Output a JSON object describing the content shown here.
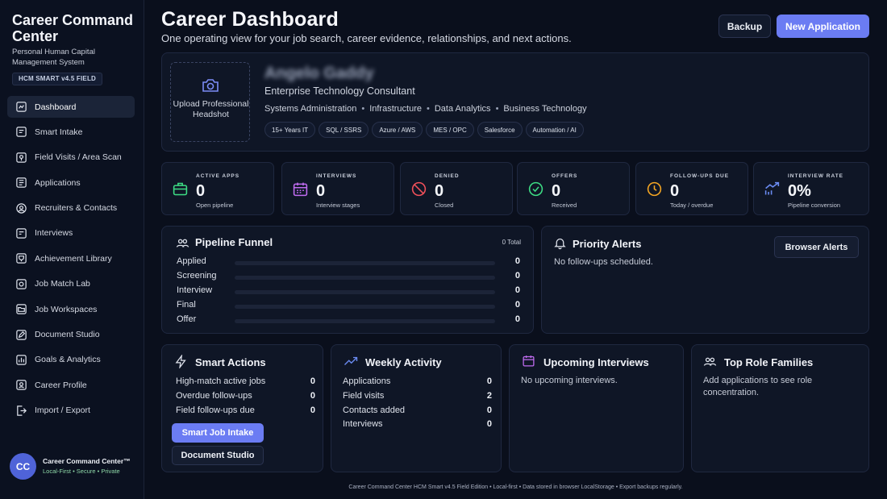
{
  "sidebar": {
    "brand_title": "Career Command Center",
    "brand_subtitle": "Personal Human Capital Management System",
    "badge": "HCM SMART v4.5 FIELD",
    "items": [
      {
        "label": "Dashboard",
        "icon": "dashboard-icon",
        "active": true
      },
      {
        "label": "Smart Intake",
        "icon": "intake-icon"
      },
      {
        "label": "Field Visits / Area Scan",
        "icon": "map-pin-icon"
      },
      {
        "label": "Applications",
        "icon": "document-icon"
      },
      {
        "label": "Recruiters & Contacts",
        "icon": "contacts-icon"
      },
      {
        "label": "Interviews",
        "icon": "chat-icon"
      },
      {
        "label": "Achievement Library",
        "icon": "trophy-icon"
      },
      {
        "label": "Job Match Lab",
        "icon": "target-icon"
      },
      {
        "label": "Job Workspaces",
        "icon": "folder-icon"
      },
      {
        "label": "Document Studio",
        "icon": "file-edit-icon"
      },
      {
        "label": "Goals & Analytics",
        "icon": "chart-icon"
      },
      {
        "label": "Career Profile",
        "icon": "user-icon"
      },
      {
        "label": "Import / Export",
        "icon": "transfer-icon"
      }
    ],
    "user": {
      "initials": "CC",
      "name": "Career Command Center™",
      "tags": "Local-First • Secure • Private"
    }
  },
  "header": {
    "title": "Career Dashboard",
    "subtitle": "One operating view for your job search, career evidence, relationships, and next actions.",
    "backup_label": "Backup",
    "new_label": "New Application"
  },
  "profile": {
    "upload_label": "Upload Professional Headshot",
    "name": "Angelo Gaddy",
    "role": "Enterprise Technology Consultant",
    "skills": [
      "Systems Administration",
      "Infrastructure",
      "Data Analytics",
      "Business Technology"
    ],
    "tags": [
      "15+ Years IT",
      "SQL / SSRS",
      "Azure / AWS",
      "MES / OPC",
      "Salesforce",
      "Automation / AI"
    ]
  },
  "stats": [
    {
      "label": "ACTIVE APPS",
      "value": "0",
      "sub": "Open pipeline",
      "icon": "briefcase-icon",
      "color": "#3ddc84"
    },
    {
      "label": "INTERVIEWS",
      "value": "0",
      "sub": "Interview stages",
      "icon": "calendar-icon",
      "color": "#c06cf0"
    },
    {
      "label": "DENIED",
      "value": "0",
      "sub": "Closed",
      "icon": "ban-icon",
      "color": "#f0505a"
    },
    {
      "label": "OFFERS",
      "value": "0",
      "sub": "Received",
      "icon": "check-circle-icon",
      "color": "#3ddc84"
    },
    {
      "label": "FOLLOW-UPS DUE",
      "value": "0",
      "sub": "Today / overdue",
      "icon": "clock-icon",
      "color": "#f5a623"
    },
    {
      "label": "INTERVIEW RATE",
      "value": "0%",
      "sub": "Pipeline conversion",
      "icon": "trend-icon",
      "color": "#6b8cf3"
    }
  ],
  "funnel": {
    "title": "Pipeline Funnel",
    "total": "0 Total",
    "rows": [
      {
        "label": "Applied",
        "value": "0",
        "fill": 0
      },
      {
        "label": "Screening",
        "value": "0",
        "fill": 0
      },
      {
        "label": "Interview",
        "value": "0",
        "fill": 0
      },
      {
        "label": "Final",
        "value": "0",
        "fill": 0
      },
      {
        "label": "Offer",
        "value": "0",
        "fill": 0
      }
    ]
  },
  "alerts": {
    "title": "Priority Alerts",
    "button": "Browser Alerts",
    "empty": "No follow-ups scheduled."
  },
  "smart_actions": {
    "title": "Smart Actions",
    "rows": [
      {
        "label": "High-match active jobs",
        "value": "0"
      },
      {
        "label": "Overdue follow-ups",
        "value": "0"
      },
      {
        "label": "Field follow-ups due",
        "value": "0"
      }
    ],
    "primary_button": "Smart Job Intake",
    "secondary_button": "Document Studio"
  },
  "weekly": {
    "title": "Weekly Activity",
    "rows": [
      {
        "label": "Applications",
        "value": "0"
      },
      {
        "label": "Field visits",
        "value": "2"
      },
      {
        "label": "Contacts added",
        "value": "0"
      },
      {
        "label": "Interviews",
        "value": "0"
      }
    ]
  },
  "upcoming": {
    "title": "Upcoming Interviews",
    "empty": "No upcoming interviews."
  },
  "role_families": {
    "title": "Top Role Families",
    "empty": "Add applications to see role concentration."
  },
  "footer": "Career Command Center HCM Smart v4.5 Field Edition • Local-first • Data stored in browser LocalStorage • Export backups regularly."
}
